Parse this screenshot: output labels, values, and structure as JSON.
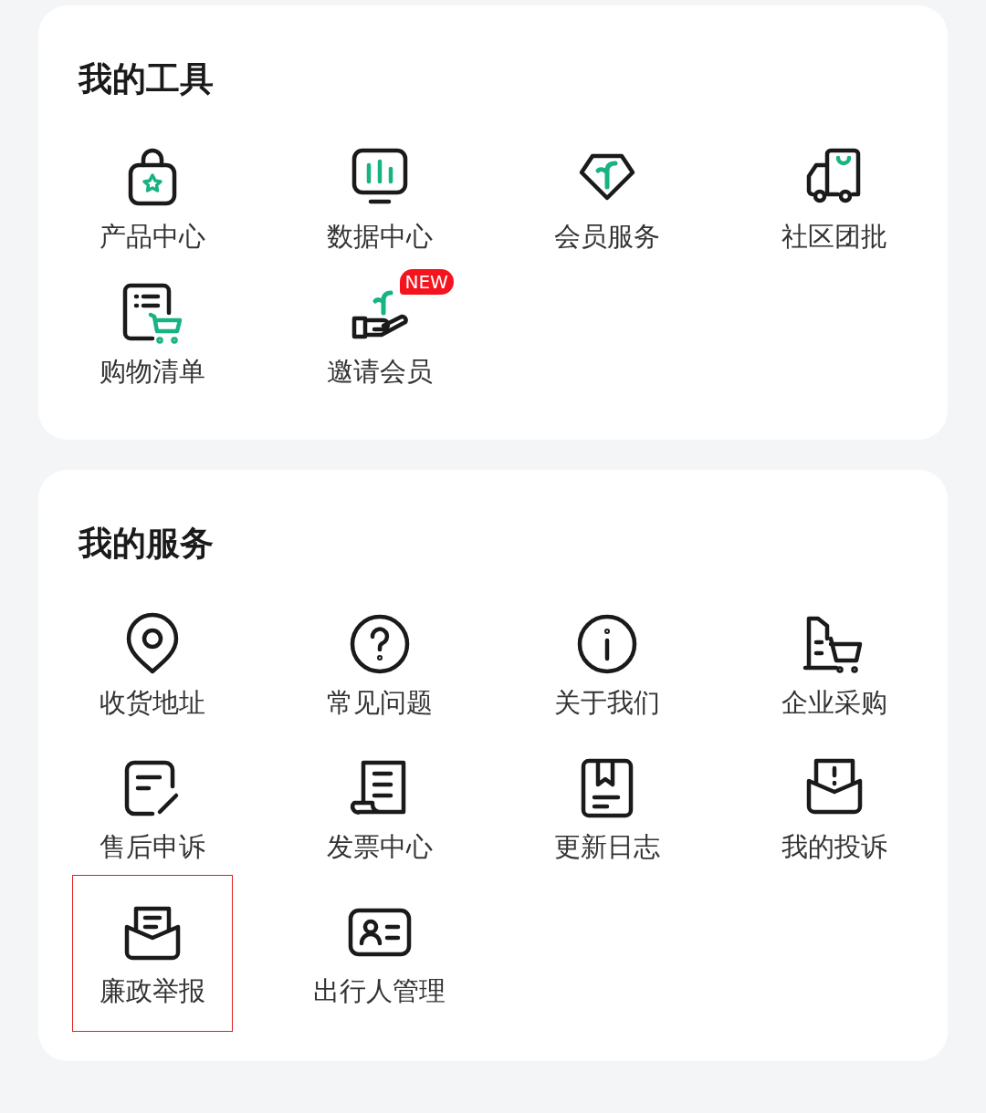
{
  "tools": {
    "title": "我的工具",
    "items": [
      {
        "label": "产品中心",
        "selected": false
      },
      {
        "label": "数据中心",
        "selected": false
      },
      {
        "label": "会员服务",
        "selected": false
      },
      {
        "label": "社区团批",
        "selected": false
      },
      {
        "label": "购物清单",
        "selected": false
      },
      {
        "label": "邀请会员",
        "badge": "NEW",
        "selected": false
      }
    ]
  },
  "services": {
    "title": "我的服务",
    "items": [
      {
        "label": "收货地址",
        "selected": false
      },
      {
        "label": "常见问题",
        "selected": false
      },
      {
        "label": "关于我们",
        "selected": false
      },
      {
        "label": "企业采购",
        "selected": false
      },
      {
        "label": "售后申诉",
        "selected": false
      },
      {
        "label": "发票中心",
        "selected": false
      },
      {
        "label": "更新日志",
        "selected": false
      },
      {
        "label": "我的投诉",
        "selected": false
      },
      {
        "label": "廉政举报",
        "selected": true
      },
      {
        "label": "出行人管理",
        "selected": false
      }
    ]
  }
}
